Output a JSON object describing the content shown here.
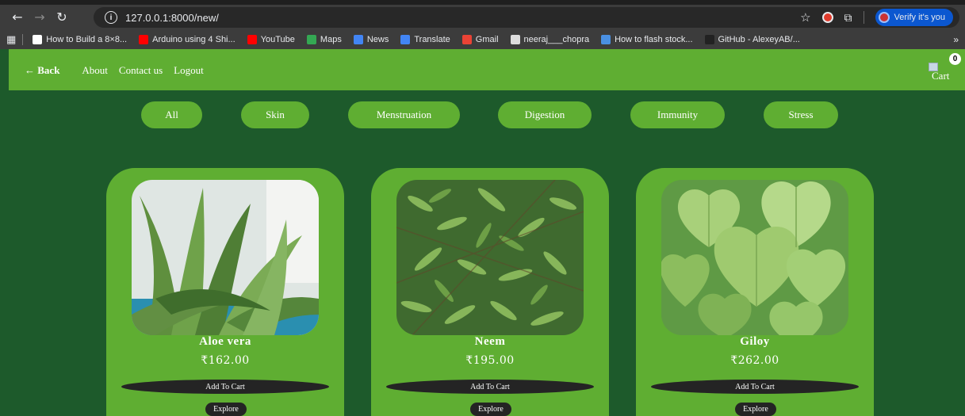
{
  "browser": {
    "url": "127.0.0.1:8000/new/",
    "profile_label": "Verify it's you",
    "bookmarks": [
      {
        "label": "How to Build a 8×8...",
        "color": "#ffffff",
        "icon": "f-letter-icon"
      },
      {
        "label": "Arduino using 4 Shi...",
        "color": "#ff0000",
        "icon": "youtube-icon"
      },
      {
        "label": "YouTube",
        "color": "#ff0000",
        "icon": "youtube-icon"
      },
      {
        "label": "Maps",
        "color": "#34a853",
        "icon": "maps-icon"
      },
      {
        "label": "News",
        "color": "#4285f4",
        "icon": "news-icon"
      },
      {
        "label": "Translate",
        "color": "#4285f4",
        "icon": "translate-icon"
      },
      {
        "label": "Gmail",
        "color": "#ea4335",
        "icon": "gmail-icon"
      },
      {
        "label": "neeraj___chopra",
        "color": "#dddddd",
        "icon": "globe-icon"
      },
      {
        "label": "How to flash stock...",
        "color": "#4a90e2",
        "icon": "bracket-icon"
      },
      {
        "label": "GitHub - AlexeyAB/...",
        "color": "#222222",
        "icon": "github-icon"
      }
    ]
  },
  "nav": {
    "back": "← Back",
    "about": "About",
    "contact": "Contact us",
    "logout": "Logout",
    "cart_label": "Cart",
    "cart_count": "0"
  },
  "filters": [
    "All",
    "Skin",
    "Menstruation",
    "Digestion",
    "Immunity",
    "Stress"
  ],
  "products": [
    {
      "name": "Aloe vera",
      "price": "₹162.00",
      "add_label": "Add To Cart",
      "explore_label": "Explore"
    },
    {
      "name": "Neem",
      "price": "₹195.00",
      "add_label": "Add To Cart",
      "explore_label": "Explore"
    },
    {
      "name": "Giloy",
      "price": "₹262.00",
      "add_label": "Add To Cart",
      "explore_label": "Explore"
    }
  ],
  "colors": {
    "page_bg": "#1d5a2b",
    "accent_green": "#5fae32",
    "button_dark": "#242424"
  }
}
